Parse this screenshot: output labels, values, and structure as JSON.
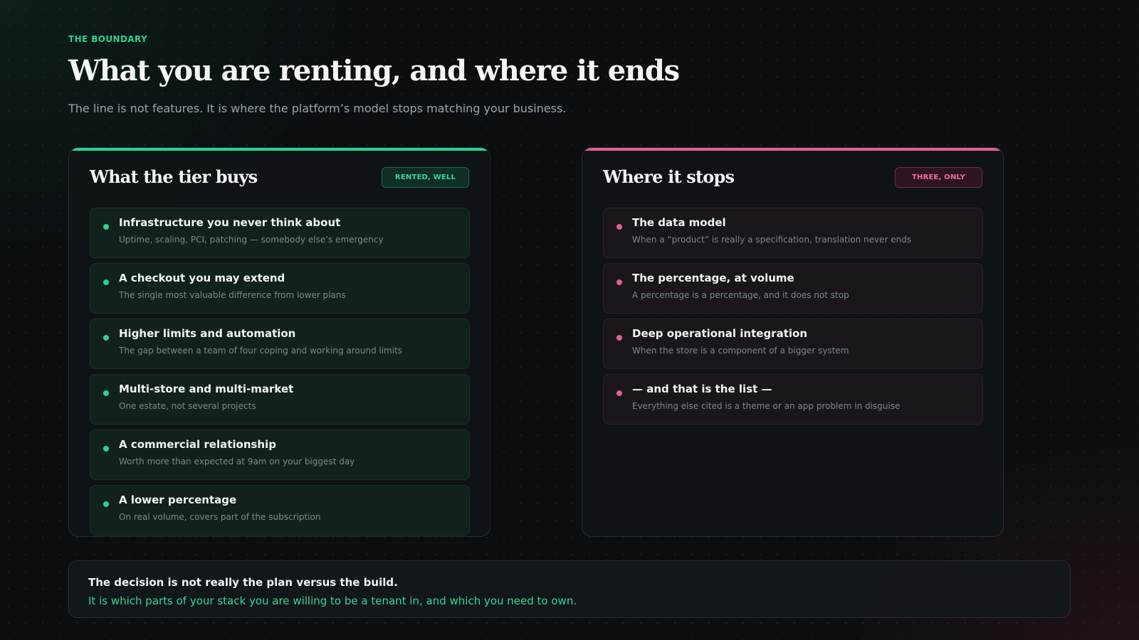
{
  "header": {
    "eyebrow": "THE BOUNDARY",
    "title": "What you are renting, and where it ends",
    "subtitle": "The line is not features. It is where the platform’s model stops matching your business."
  },
  "colors": {
    "accent_green": "#2fd08f",
    "accent_pink": "#e35f95",
    "background": "#0b0f12"
  },
  "left_panel": {
    "title": "What the tier buys",
    "badge": "RENTED, WELL",
    "items": [
      {
        "title": "Infrastructure you never think about",
        "desc": "Uptime, scaling, PCI, patching — somebody else’s emergency"
      },
      {
        "title": "A checkout you may extend",
        "desc": "The single most valuable difference from lower plans"
      },
      {
        "title": "Higher limits and automation",
        "desc": "The gap between a team of four coping and working around limits"
      },
      {
        "title": "Multi-store and multi-market",
        "desc": "One estate, not several projects"
      },
      {
        "title": "A commercial relationship",
        "desc": "Worth more than expected at 9am on your biggest day"
      },
      {
        "title": "A lower percentage",
        "desc": "On real volume, covers part of the subscription"
      }
    ]
  },
  "right_panel": {
    "title": "Where it stops",
    "badge": "THREE, ONLY",
    "items": [
      {
        "title": "The data model",
        "desc": "When a “product” is really a specification, translation never ends"
      },
      {
        "title": "The percentage, at volume",
        "desc": "A percentage is a percentage, and it does not stop"
      },
      {
        "title": "Deep operational integration",
        "desc": "When the store is a component of a bigger system"
      },
      {
        "title": "— and that is the list —",
        "desc": "Everything else cited is a theme or an app problem in disguise"
      }
    ]
  },
  "footer": {
    "line1": "The decision is not really the plan versus the build.",
    "line2": "It is which parts of your stack you are willing to be a tenant in, and which you need to own."
  }
}
